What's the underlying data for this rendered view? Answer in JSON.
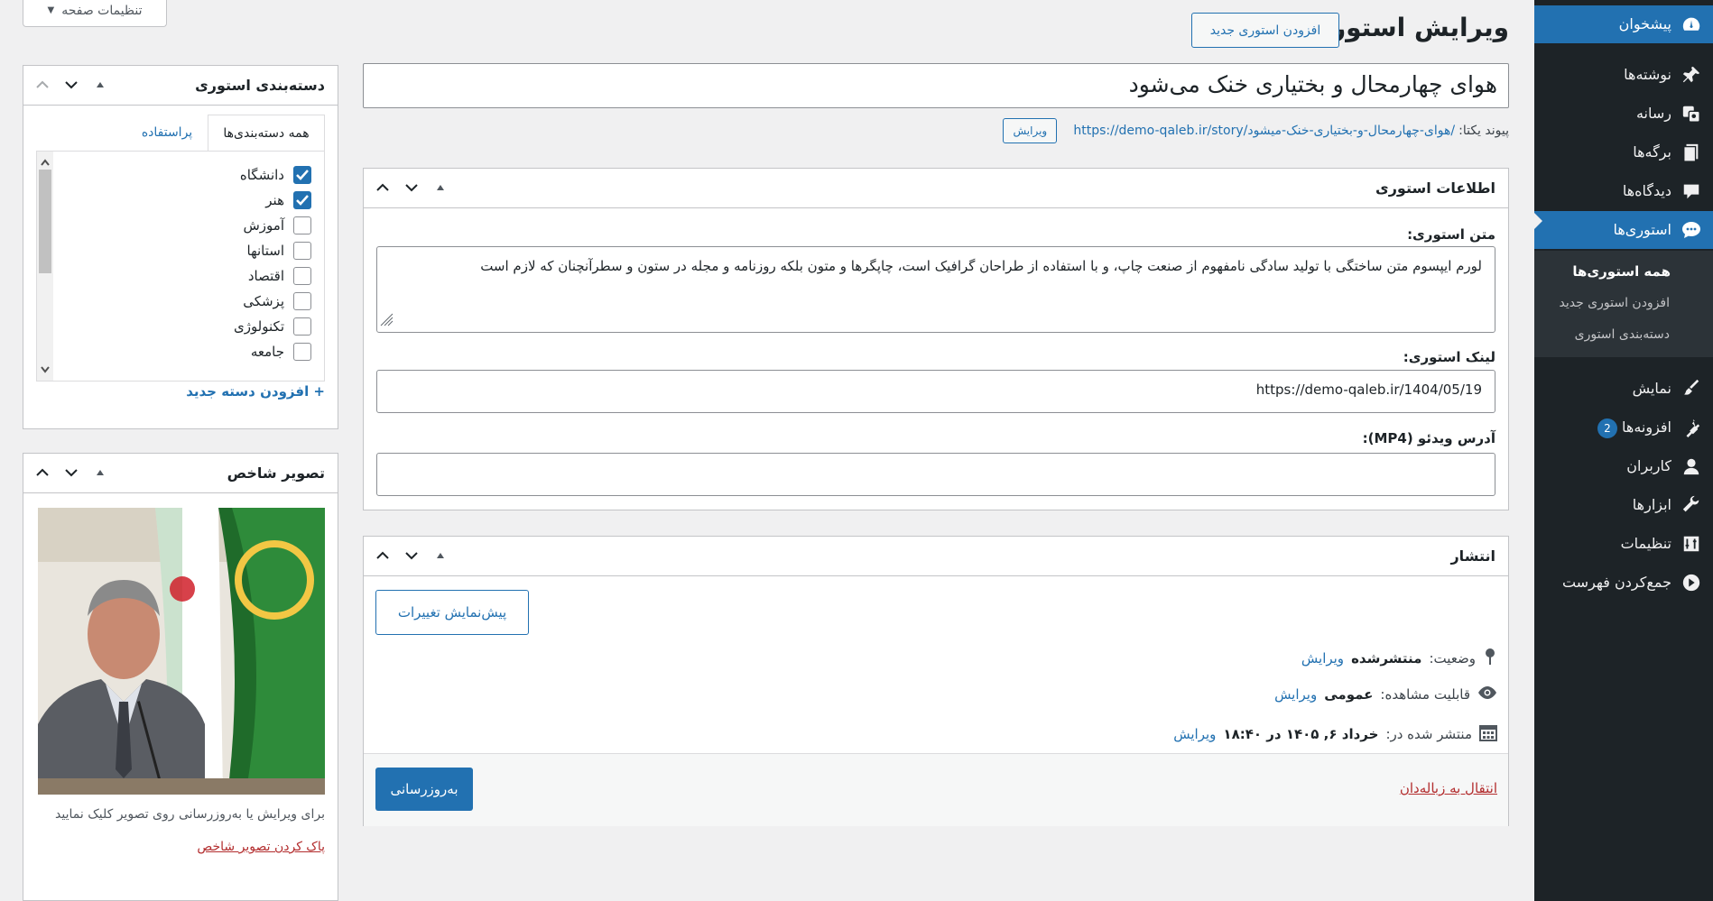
{
  "header": {
    "page_title": "ویرایش استوری",
    "add_new_label": "افزودن استوری جدید",
    "screen_options_label": "تنظیمات صفحه"
  },
  "post": {
    "title": "هوای چهارمحال و بختیاری خنک می‌شود",
    "permalink_label": "پیوند یکتا:",
    "permalink_url": "https://demo-qaleb.ir/story/هوای-چهارمحال-و-بختیاری-خنک-میشود/",
    "permalink_edit": "ویرایش"
  },
  "story_info": {
    "title": "اطلاعات استوری",
    "text_label": "متن استوری:",
    "text_value": "لورم ایپسوم متن ساختگی با تولید سادگی نامفهوم از صنعت چاپ، و با استفاده از طراحان گرافیک است، چاپگرها و متون بلکه روزنامه و مجله در ستون و سطرآنچنان که لازم است",
    "link_label": "لینک استوری:",
    "link_value": "https://demo-qaleb.ir/1404/05/19",
    "video_label": "آدرس ویدئو (MP4):",
    "video_value": ""
  },
  "publish": {
    "title": "انتشار",
    "preview_label": "پیش‌نمایش تغییرات",
    "status_label": "وضعیت:",
    "status_value": "منتشرشده",
    "status_edit": "ویرایش",
    "visibility_label": "قابلیت مشاهده:",
    "visibility_value": "عمومی",
    "visibility_edit": "ویرایش",
    "published_label": "منتشر شده در:",
    "published_value": "خرداد ۶, ۱۴۰۵ در ۱۸:۴۰",
    "published_edit": "ویرایش",
    "update_label": "به‌روزرسانی",
    "trash_label": "انتقال به زباله‌دان"
  },
  "categories": {
    "title": "دسته‌بندی استوری",
    "tab_all": "همه دسته‌بندی‌ها",
    "tab_popular": "پراستفاده",
    "items": [
      {
        "label": "دانشگاه",
        "checked": true
      },
      {
        "label": "هنر",
        "checked": true
      },
      {
        "label": "آموزش",
        "checked": false
      },
      {
        "label": "استانها",
        "checked": false
      },
      {
        "label": "اقتصاد",
        "checked": false
      },
      {
        "label": "پزشکی",
        "checked": false
      },
      {
        "label": "تکنولوژی",
        "checked": false
      },
      {
        "label": "جامعه",
        "checked": false
      }
    ],
    "add_new": "+ افزودن دسته جدید"
  },
  "featured": {
    "title": "تصویر شاخص",
    "hint": "برای ویرایش یا به‌روزرسانی روی تصویر کلیک نمایید",
    "remove": "پاک کردن تصویر شاخص"
  },
  "menu": {
    "items": [
      {
        "label": "پیشخوان",
        "icon": "dashboard-icon"
      },
      {
        "label": "نوشته‌ها",
        "icon": "pin-icon"
      },
      {
        "label": "رسانه",
        "icon": "media-icon"
      },
      {
        "label": "برگه‌ها",
        "icon": "pages-icon"
      },
      {
        "label": "دیدگاه‌ها",
        "icon": "comments-icon"
      },
      {
        "label": "استوری‌ها",
        "icon": "stories-icon"
      },
      {
        "label": "نمایش",
        "icon": "appearance-icon"
      },
      {
        "label": "افزونه‌ها",
        "icon": "plugins-icon",
        "badge": "2"
      },
      {
        "label": "کاربران",
        "icon": "users-icon"
      },
      {
        "label": "ابزارها",
        "icon": "tools-icon"
      },
      {
        "label": "تنظیمات",
        "icon": "settings-icon"
      },
      {
        "label": "جمع‌کردن فهرست",
        "icon": "collapse-icon"
      }
    ],
    "submenu": [
      "همه استوری‌ها",
      "افزودن استوری جدید",
      "دسته‌بندی استوری"
    ]
  },
  "colors": {
    "accent": "#2271b1",
    "menu_bg": "#1d2327",
    "danger": "#b32d2e"
  }
}
